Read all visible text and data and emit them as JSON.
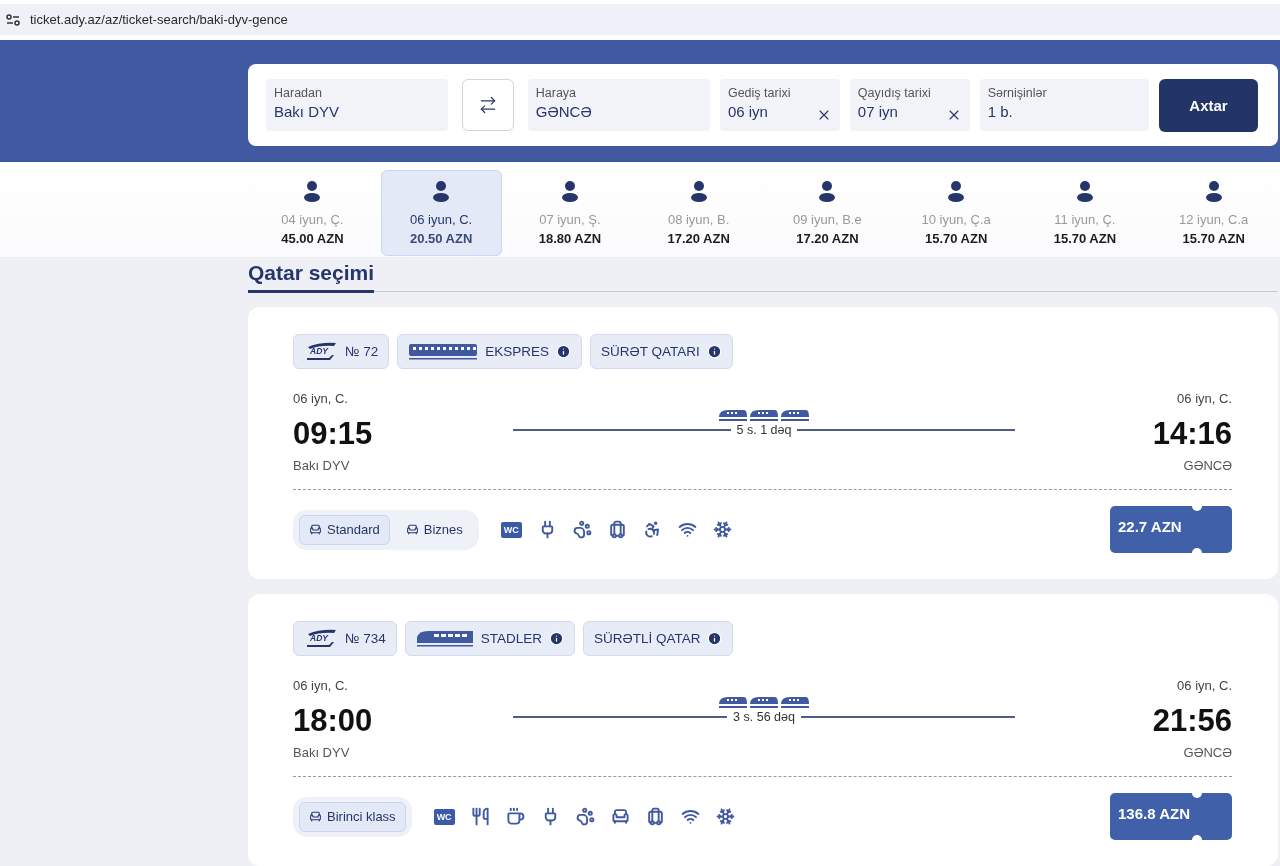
{
  "browser": {
    "url": "ticket.ady.az/az/ticket-search/baki-dyv-gence"
  },
  "search": {
    "from": {
      "label": "Haradan",
      "value": "Bakı DYV"
    },
    "to": {
      "label": "Haraya",
      "value": "GƏNCƏ"
    },
    "dates": [
      {
        "label": "Gediş tarixi",
        "value": "06 iyn",
        "clearable": true
      },
      {
        "label": "Qayıdış tarixi",
        "value": "07 iyn",
        "clearable": true
      }
    ],
    "passengers": {
      "label": "Sərnişinlər",
      "value": "1 b."
    },
    "button": "Axtar"
  },
  "date_strip": [
    {
      "date": "04 iyun, Ç.",
      "price": "45.00 AZN",
      "selected": false
    },
    {
      "date": "06 iyun, C.",
      "price": "20.50 AZN",
      "selected": true
    },
    {
      "date": "07 iyun, Ş.",
      "price": "18.80 AZN",
      "selected": false
    },
    {
      "date": "08 iyun, B.",
      "price": "17.20 AZN",
      "selected": false
    },
    {
      "date": "09 iyun, B.e",
      "price": "17.20 AZN",
      "selected": false
    },
    {
      "date": "10 iyun, Ç.a",
      "price": "15.70 AZN",
      "selected": false
    },
    {
      "date": "11 iyun, Ç.",
      "price": "15.70 AZN",
      "selected": false
    },
    {
      "date": "12 iyun, C.a",
      "price": "15.70 AZN",
      "selected": false
    }
  ],
  "section_title": "Qatar seçimi",
  "trains": [
    {
      "operator": "ADY",
      "number": "№ 72",
      "train_type": {
        "kind": "ekspres",
        "label": "EKSPRES"
      },
      "category": "SÜRƏT QATARI",
      "departure": {
        "date": "06 iyn, C.",
        "time": "09:15",
        "station": "Bakı DYV"
      },
      "arrival": {
        "date": "06 iyn, C.",
        "time": "14:16",
        "station": "GƏNCƏ"
      },
      "duration": "5 s. 1 dəq",
      "classes": [
        {
          "label": "Standard",
          "selected": true
        },
        {
          "label": "Biznes",
          "selected": false
        }
      ],
      "amenities": [
        {
          "kind": "wc",
          "label": "WC"
        },
        {
          "kind": "plug"
        },
        {
          "kind": "pet"
        },
        {
          "kind": "luggage"
        },
        {
          "kind": "wheelchair"
        },
        {
          "kind": "wifi"
        },
        {
          "kind": "ac"
        }
      ],
      "price": "22.7 AZN"
    },
    {
      "operator": "ADY",
      "number": "№ 734",
      "train_type": {
        "kind": "stadler",
        "label": "STADLER"
      },
      "category": "SÜRƏTLİ QATAR",
      "departure": {
        "date": "06 iyn, C.",
        "time": "18:00",
        "station": "Bakı DYV"
      },
      "arrival": {
        "date": "06 iyn, C.",
        "time": "21:56",
        "station": "GƏNCƏ"
      },
      "duration": "3 s. 56 dəq",
      "classes": [
        {
          "label": "Birinci klass",
          "selected": true
        }
      ],
      "amenities": [
        {
          "kind": "wc",
          "label": "WC"
        },
        {
          "kind": "food"
        },
        {
          "kind": "coffee"
        },
        {
          "kind": "plug"
        },
        {
          "kind": "pet"
        },
        {
          "kind": "seat"
        },
        {
          "kind": "luggage"
        },
        {
          "kind": "wifi"
        },
        {
          "kind": "ac"
        }
      ],
      "price": "136.8 AZN"
    }
  ]
}
